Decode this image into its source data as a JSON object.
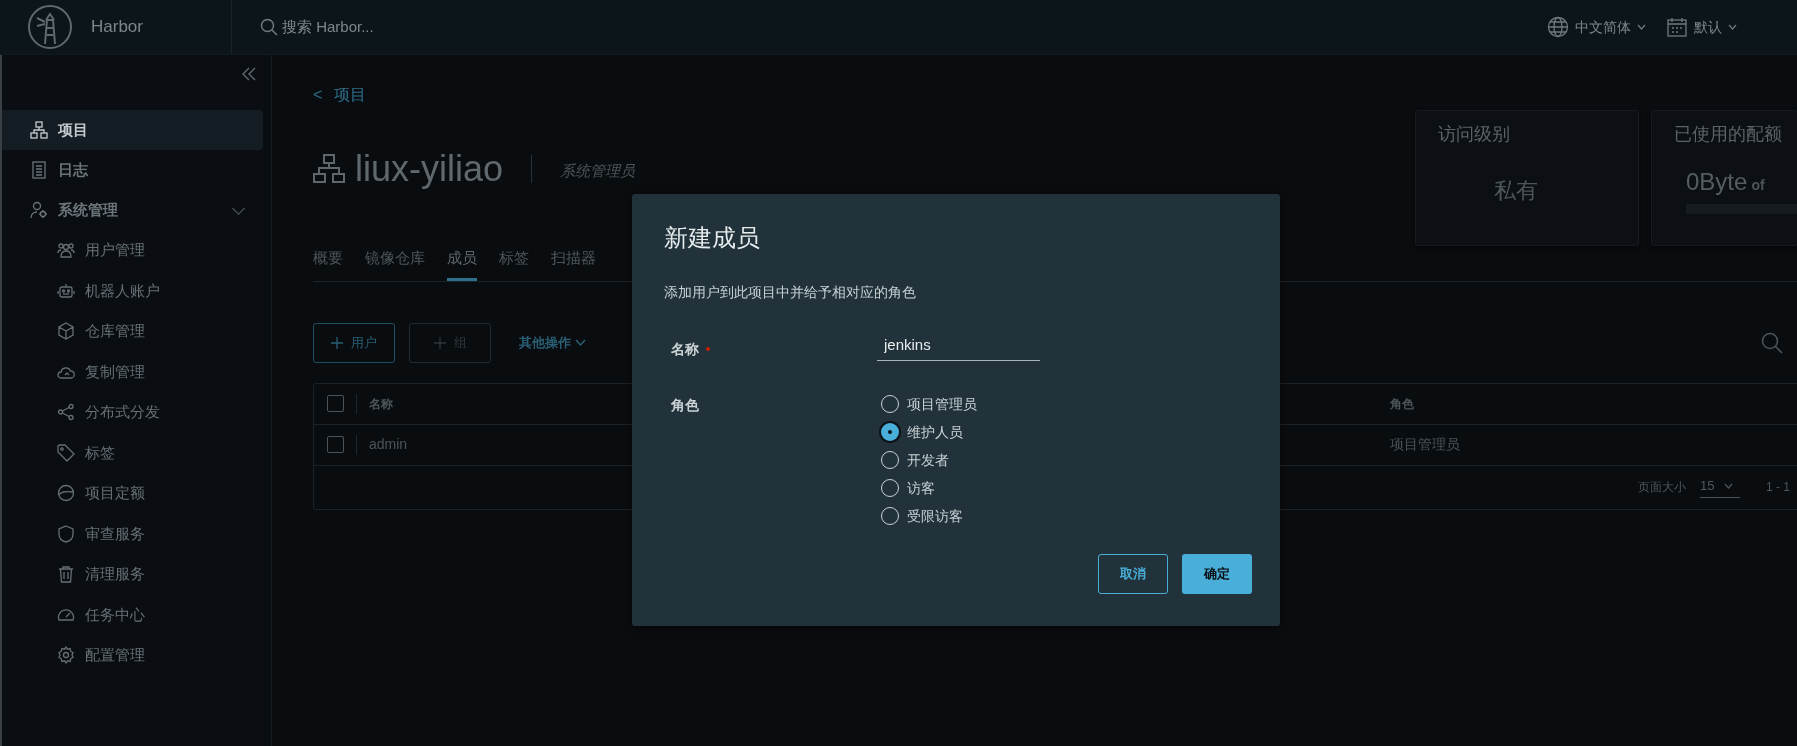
{
  "header": {
    "brand": "Harbor",
    "search_placeholder": "搜索 Harbor...",
    "language": "中文简体",
    "theme": "默认"
  },
  "sidebar": {
    "items": [
      {
        "label": "项目",
        "selected": true
      },
      {
        "label": "日志",
        "selected": false
      },
      {
        "label": "系统管理",
        "selected": false,
        "expanded": true,
        "children": [
          {
            "label": "用户管理",
            "selected": false
          },
          {
            "label": "机器人账户",
            "selected": false
          },
          {
            "label": "仓库管理",
            "selected": false
          },
          {
            "label": "复制管理",
            "selected": false
          },
          {
            "label": "分布式分发",
            "selected": false
          },
          {
            "label": "标签",
            "selected": false
          },
          {
            "label": "项目定额",
            "selected": false
          },
          {
            "label": "审查服务",
            "selected": false
          },
          {
            "label": "清理服务",
            "selected": false
          },
          {
            "label": "任务中心",
            "selected": false
          },
          {
            "label": "配置管理",
            "selected": false
          }
        ]
      }
    ]
  },
  "breadcrumb": {
    "back": "<",
    "label": "项目"
  },
  "project": {
    "name": "liux-yiliao",
    "role": "系统管理员"
  },
  "cards": [
    {
      "kind": "text",
      "title": "访问级别",
      "value": "私有"
    },
    {
      "kind": "quota",
      "title": "已使用的配额",
      "amount": "0Byte",
      "of": "of"
    }
  ],
  "tabs": [
    {
      "label": "概要",
      "selected": false
    },
    {
      "label": "镜像仓库",
      "selected": false
    },
    {
      "label": "成员",
      "selected": true
    },
    {
      "label": "标签",
      "selected": false
    },
    {
      "label": "扫描器",
      "selected": false
    }
  ],
  "actions": [
    {
      "kind": "add",
      "label": "用户",
      "disabled": false
    },
    {
      "kind": "add",
      "label": "组",
      "disabled": true
    },
    {
      "kind": "dropdown",
      "label": "其他操作",
      "disabled": false
    }
  ],
  "table": {
    "header_checked": false,
    "columns": [
      "名称",
      "角色"
    ],
    "rows": [
      {
        "checked": false,
        "cells": [
          "admin",
          "项目管理员"
        ]
      }
    ],
    "footer": {
      "page_size_label": "页面大小",
      "page_size": "15",
      "range": "1 - 1"
    }
  },
  "dialog": {
    "title": "新建成员",
    "description": "添加用户到此项目中并给予相对应的角色",
    "fields": [
      {
        "kind": "text",
        "label": "名称",
        "required": true,
        "value": "jenkins"
      },
      {
        "kind": "radio",
        "label": "角色",
        "options": [
          {
            "label": "项目管理员",
            "selected": false
          },
          {
            "label": "维护人员",
            "selected": true
          },
          {
            "label": "开发者",
            "selected": false
          },
          {
            "label": "访客",
            "selected": false
          },
          {
            "label": "受限访客",
            "selected": false
          }
        ]
      }
    ],
    "buttons": [
      {
        "kind": "secondary",
        "label": "取消"
      },
      {
        "kind": "primary",
        "label": "确定"
      }
    ]
  }
}
